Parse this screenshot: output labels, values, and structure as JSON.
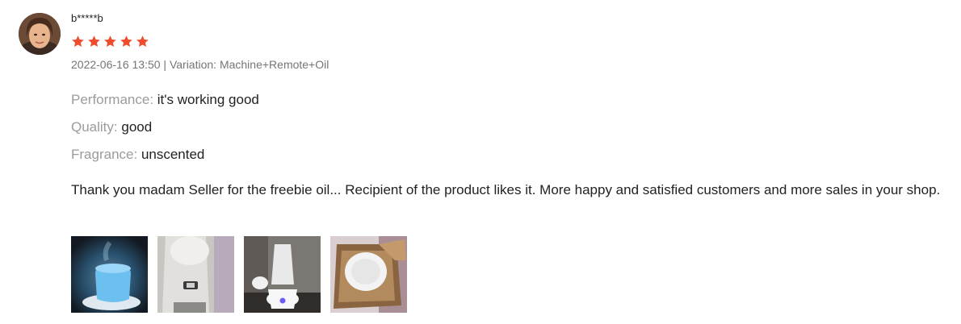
{
  "review": {
    "username": "b*****b",
    "rating": 5,
    "rating_max": 5,
    "star_color": "#ee4d2d",
    "meta": "2022-06-16 13:50 | Variation: Machine+Remote+Oil",
    "attributes": [
      {
        "key": "Performance:",
        "value": "it's working good"
      },
      {
        "key": "Quality:",
        "value": "good"
      },
      {
        "key": "Fragrance:",
        "value": "unscented"
      }
    ],
    "comment": "Thank you madam Seller for the freebie oil... Recipient of the product likes it. More happy and satisfied customers and more sales in your shop.",
    "photos": [
      {
        "name": "review-photo-glowing-diffuser"
      },
      {
        "name": "review-photo-diffuser-closeup"
      },
      {
        "name": "review-photo-diffuser-on-table"
      },
      {
        "name": "review-photo-diffuser-in-box"
      }
    ]
  }
}
